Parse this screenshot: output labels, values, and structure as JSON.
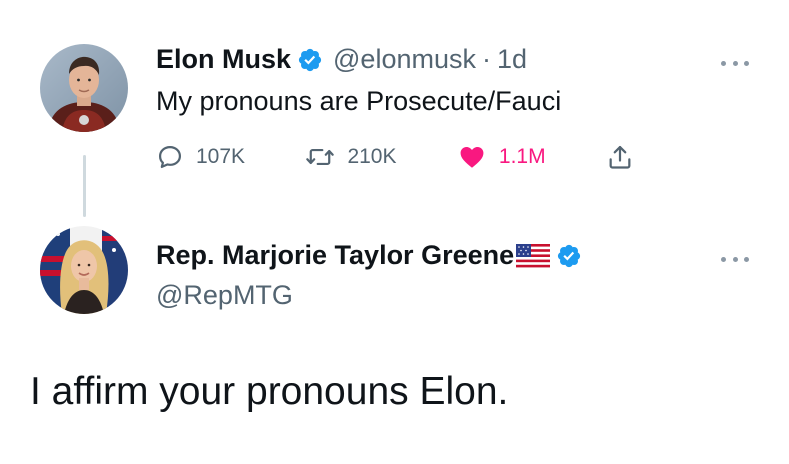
{
  "tweet": {
    "author_name": "Elon Musk",
    "author_handle": "@elonmusk",
    "separator": "·",
    "time": "1d",
    "text": "My pronouns are Prosecute/Fauci",
    "replies": "107K",
    "retweets": "210K",
    "likes": "1.1M",
    "liked": true,
    "verified": true
  },
  "reply": {
    "author_name": "Rep. Marjorie Taylor Greene",
    "author_handle": "@RepMTG",
    "text": "I affirm your pronouns Elon.",
    "verified": true,
    "name_emoji": "us-flag-icon"
  },
  "colors": {
    "text": "#0f1419",
    "secondary": "#536471",
    "verified_blue": "#1d9bf0",
    "like_pink": "#f91880",
    "thread_line": "#cfd9de"
  }
}
